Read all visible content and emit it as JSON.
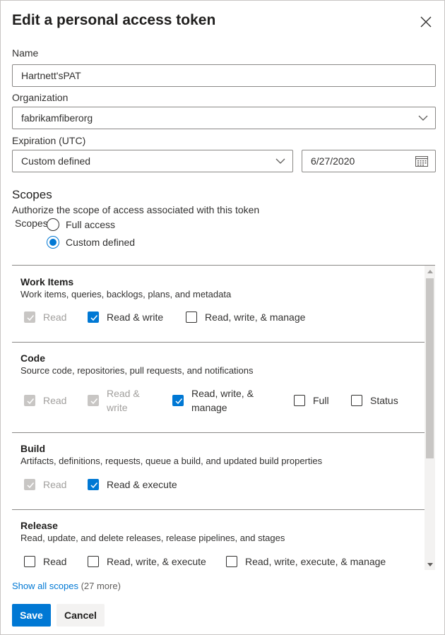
{
  "dialog": {
    "title": "Edit a personal access token",
    "close_icon": "close-icon"
  },
  "name": {
    "label": "Name",
    "value": "Hartnett'sPAT"
  },
  "organization": {
    "label": "Organization",
    "value": "fabrikamfiberorg",
    "icon": "chevron-down-icon"
  },
  "expiration": {
    "label": "Expiration (UTC)",
    "value": "Custom defined",
    "date": "6/27/2020",
    "date_icon": "calendar-icon"
  },
  "scopes": {
    "title": "Scopes",
    "description": "Authorize the scope of access associated with this token",
    "radio_label": "Scopes",
    "options": [
      {
        "label": "Full access",
        "selected": false
      },
      {
        "label": "Custom defined",
        "selected": true
      }
    ]
  },
  "sections": [
    {
      "title": "Work Items",
      "description": "Work items, queries, backlogs, plans, and metadata",
      "options": [
        {
          "label": "Read",
          "state": "disabled-checked"
        },
        {
          "label": "Read & write",
          "state": "checked"
        },
        {
          "label": "Read, write, & manage",
          "state": "unchecked"
        }
      ]
    },
    {
      "title": "Code",
      "description": "Source code, repositories, pull requests, and notifications",
      "options": [
        {
          "label": "Read",
          "state": "disabled-checked"
        },
        {
          "label_line1": "Read &",
          "label_line2": "write",
          "state": "disabled-checked"
        },
        {
          "label_line1": "Read, write, &",
          "label_line2": "manage",
          "state": "checked"
        },
        {
          "label": "Full",
          "state": "unchecked"
        },
        {
          "label": "Status",
          "state": "unchecked"
        }
      ]
    },
    {
      "title": "Build",
      "description": "Artifacts, definitions, requests, queue a build, and updated build properties",
      "options": [
        {
          "label": "Read",
          "state": "disabled-checked"
        },
        {
          "label": "Read & execute",
          "state": "checked"
        }
      ]
    },
    {
      "title": "Release",
      "description": "Read, update, and delete releases, release pipelines, and stages",
      "options": [
        {
          "label": "Read",
          "state": "unchecked"
        },
        {
          "label": "Read, write, & execute",
          "state": "unchecked"
        },
        {
          "label": "Read, write, execute, & manage",
          "state": "unchecked"
        }
      ]
    }
  ],
  "show_all": {
    "link": "Show all scopes",
    "count": "(27 more)"
  },
  "buttons": {
    "save": "Save",
    "cancel": "Cancel"
  },
  "colors": {
    "accent": "#0078d4",
    "border": "#8a8886",
    "disabled": "#c8c6c4"
  }
}
